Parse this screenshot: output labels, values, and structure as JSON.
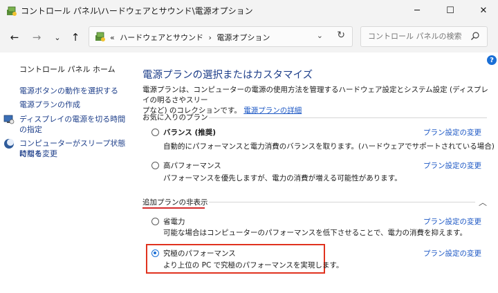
{
  "window": {
    "title": "コントロール パネル\\ハードウェアとサウンド\\電源オプション",
    "icon": "power-options-icon"
  },
  "nav": {
    "address": {
      "prefix": "«",
      "crumbs": [
        "ハードウェアとサウンド",
        "›",
        "電源オプション"
      ]
    },
    "search_placeholder": "コントロール パネルの検索"
  },
  "sidebar": {
    "home": "コントロール パネル ホーム",
    "links": [
      "電源ボタンの動作を選択する",
      "電源プランの作成",
      "ディスプレイの電源を切る時間の指定",
      "コンピューターがスリープ状態になる",
      "時間を変更"
    ]
  },
  "main": {
    "title": "電源プランの選択またはカスタマイズ",
    "desc_1": "電源プランは、コンピューターの電源の使用方法を管理するハードウェア設定とシステム設定 (ディスプレイの明るさやスリー",
    "desc_2": "プなど) のコレクションです。",
    "desc_link": "電源プランの詳細",
    "favorites_header": "お気に入りのプラン",
    "hidden_header": "追加プランの非表示",
    "change_label": "プラン設定の変更",
    "plans": [
      {
        "name": "バランス (推奨)",
        "desc": "自動的にパフォーマンスと電力消費のバランスを取ります。(ハードウェアでサポートされている場合)",
        "selected": false
      },
      {
        "name": "高パフォーマンス",
        "desc": "パフォーマンスを優先しますが、電力の消費が増える可能性があります。",
        "selected": false
      },
      {
        "name": "省電力",
        "desc": "可能な場合はコンピューターのパフォーマンスを低下させることで、電力の消費を抑えます。",
        "selected": false
      },
      {
        "name": "究極のパフォーマンス",
        "desc": "より上位の PC で究極のパフォーマンスを実現します。",
        "selected": true
      }
    ]
  },
  "colors": {
    "link": "#1a56c4",
    "title": "#1e3f8a",
    "highlight": "#e0321e",
    "accent": "#1a6fd6"
  }
}
